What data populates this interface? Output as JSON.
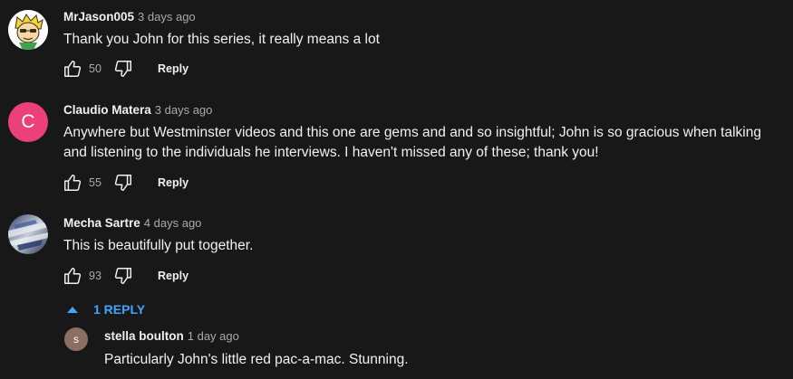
{
  "comments": [
    {
      "author": "MrJason005",
      "time": "3 days ago",
      "text": "Thank you John for this series, it really means a lot",
      "likes": "50",
      "reply_label": "Reply",
      "avatar_icon": "cartoon-character-avatar"
    },
    {
      "author": "Claudio Matera",
      "time": "3 days ago",
      "text": "Anywhere but Westminster videos  and this one are gems and and so insightful; John is so gracious when talking and listening to the individuals he interviews. I haven't missed any of these; thank you!",
      "likes": "55",
      "reply_label": "Reply",
      "avatar_letter": "C",
      "avatar_color": "#ec407a"
    },
    {
      "author": "Mecha Sartre",
      "time": "4 days ago",
      "text": "This is beautifully put together.",
      "likes": "93",
      "reply_label": "Reply",
      "avatar_icon": "abstract-photo-avatar"
    }
  ],
  "replies_toggle": {
    "label": "1 REPLY",
    "icon": "triangle-up-icon",
    "color": "#3ea6ff"
  },
  "reply": {
    "author": "stella boulton",
    "time": "1 day ago",
    "text": "Particularly John's little red pac-a-mac. Stunning.",
    "avatar_letter": "s",
    "avatar_color": "#8d6e63"
  },
  "icons": {
    "like": "thumbs-up-icon",
    "dislike": "thumbs-down-icon"
  }
}
